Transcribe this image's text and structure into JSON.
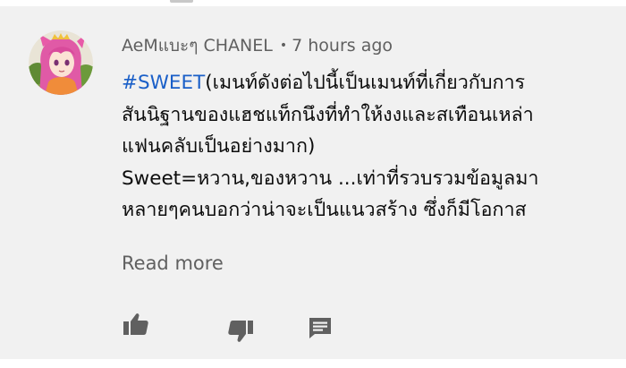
{
  "comment": {
    "author": "AeMแบะๆ CHANEL",
    "separator": "•",
    "time_ago": "7 hours ago",
    "hashtag": "#SWEET",
    "lines": [
      "(เมนท์ดังต่อไปนี้เป็นเมนท์ที่เกี่ยวกับการ",
      "สันนิฐานของแฮชแท็กนึงที่ทำให้งงและสเทือนเหล่า",
      "แฟนคลับเป็นอย่างมาก)",
      "Sweet=หวาน,ของหวาน ...เท่าที่รวบรวมข้อมูลมา",
      "หลายๆคนบอกว่าน่าจะเป็นแนวสร้าง ซึ่งก็มีโอกาส"
    ],
    "read_more": "Read more"
  },
  "actions": {
    "like_icon": "thumb-up-icon",
    "dislike_icon": "thumb-down-icon",
    "reply_icon": "comment-icon"
  },
  "colors": {
    "background": "#f1f1f1",
    "hashtag": "#1a5fc8",
    "meta_text": "#606060",
    "body_text": "#0d0d0d",
    "icon": "#606060"
  }
}
